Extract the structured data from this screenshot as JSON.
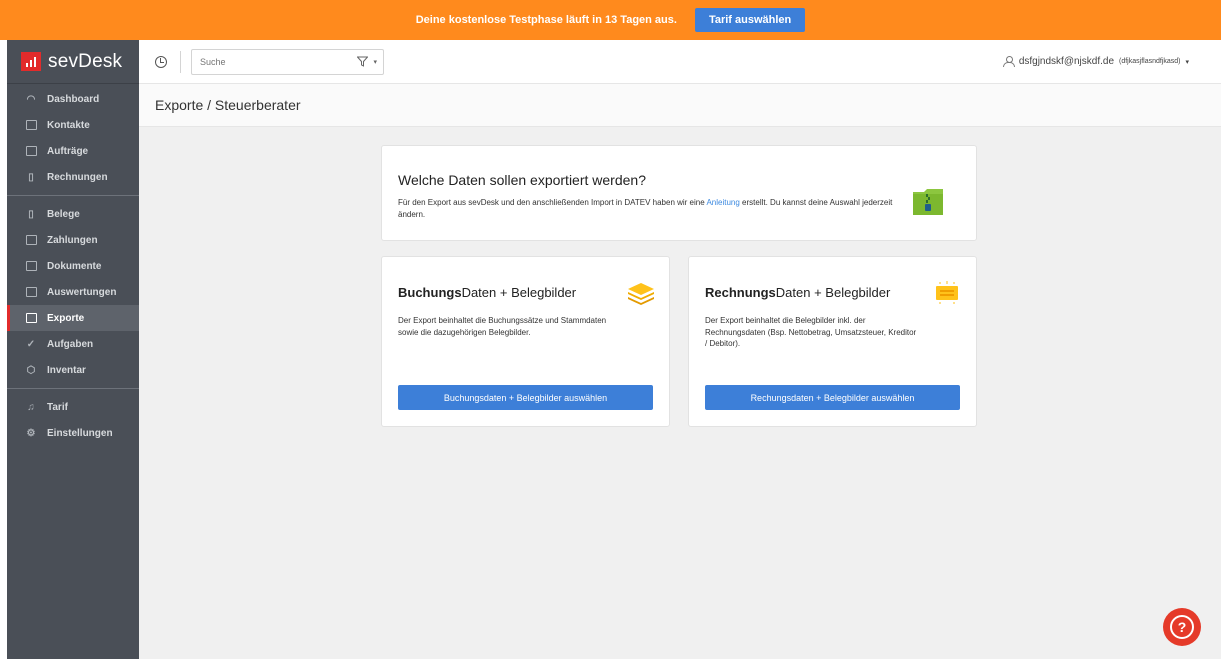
{
  "banner": {
    "text": "Deine kostenlose Testphase läuft in 13 Tagen aus.",
    "button": "Tarif auswählen"
  },
  "brand": {
    "name": "sevDesk"
  },
  "sidebar": {
    "groups": [
      [
        {
          "label": "Dashboard",
          "icon": "dashboard-icon"
        },
        {
          "label": "Kontakte",
          "icon": "contacts-icon"
        },
        {
          "label": "Aufträge",
          "icon": "orders-icon"
        },
        {
          "label": "Rechnungen",
          "icon": "invoice-icon"
        }
      ],
      [
        {
          "label": "Belege",
          "icon": "receipt-icon"
        },
        {
          "label": "Zahlungen",
          "icon": "payment-icon"
        },
        {
          "label": "Dokumente",
          "icon": "documents-icon"
        },
        {
          "label": "Auswertungen",
          "icon": "reports-icon"
        },
        {
          "label": "Exporte",
          "icon": "export-icon",
          "active": true
        },
        {
          "label": "Aufgaben",
          "icon": "check-icon"
        },
        {
          "label": "Inventar",
          "icon": "inventory-icon"
        }
      ],
      [
        {
          "label": "Tarif",
          "icon": "bell-icon"
        },
        {
          "label": "Einstellungen",
          "icon": "gear-icon"
        }
      ]
    ]
  },
  "topbar": {
    "search_placeholder": "Suche",
    "user_email": "dsfgjndskf@njskdf.de",
    "user_company": "(dfjkasjflasndfjkasd)"
  },
  "page": {
    "title": "Exporte / Steuerberater"
  },
  "intro": {
    "title": "Welche Daten sollen exportiert werden?",
    "text_before": "Für den Export aus sevDesk und den anschließenden Import in DATEV haben wir eine ",
    "link": "Anleitung",
    "text_after": " erstellt. Du kannst deine Auswahl jederzeit ändern."
  },
  "cards": [
    {
      "title_bold": "Buchungs",
      "title_rest": "Daten + Belegbilder",
      "description": "Der Export beinhaltet die Buchungssätze und Stammdaten sowie die dazugehörigen Belegbilder.",
      "button": "Buchungsdaten + Belegbilder auswählen"
    },
    {
      "title_bold": "Rechnungs",
      "title_rest": "Daten + Belegbilder",
      "description": "Der Export beinhaltet die Belegbilder inkl. der Rechnungsdaten (Bsp. Nettobetrag, Umsatzsteuer, Kreditor / Debitor).",
      "button": "Rechungsdaten + Belegbilder auswählen"
    }
  ],
  "colors": {
    "banner": "#ff8a1d",
    "primary_button": "#3d7fd8",
    "sidebar": "#4a4f57",
    "help": "#e53a29"
  }
}
